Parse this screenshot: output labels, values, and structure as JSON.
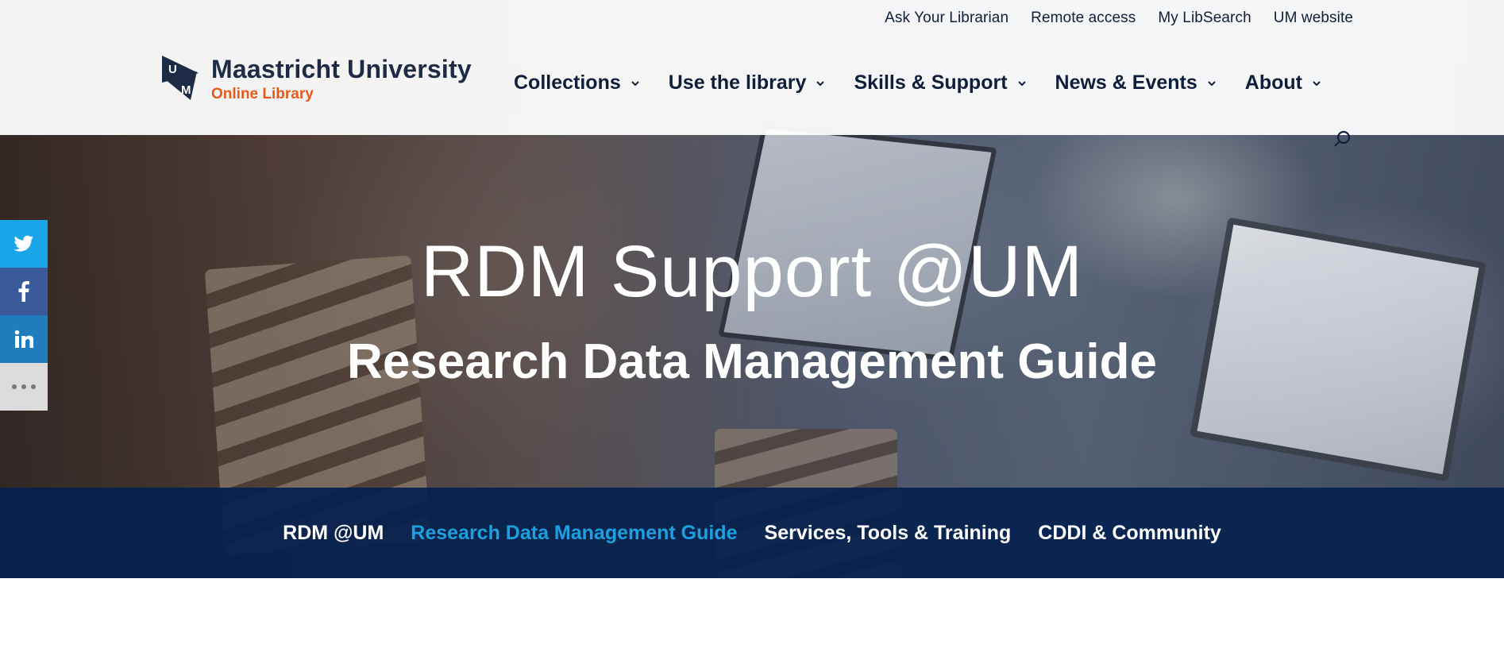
{
  "topbar": {
    "links": [
      "Ask Your Librarian",
      "Remote access",
      "My LibSearch",
      "UM website"
    ]
  },
  "logo": {
    "title": "Maastricht University",
    "subtitle": "Online Library",
    "mark_letters": [
      "U",
      "M"
    ]
  },
  "mainnav": {
    "items": [
      "Collections",
      "Use the library",
      "Skills & Support",
      "News & Events",
      "About"
    ]
  },
  "hero": {
    "title": "RDM Support @UM",
    "subtitle": "Research Data Management Guide"
  },
  "subnav": {
    "items": [
      "RDM @UM",
      "Research Data Management Guide",
      "Services, Tools & Training",
      "CDDI & Community"
    ],
    "active": "Research Data Management Guide"
  },
  "social": {
    "icons": [
      "twitter-icon",
      "facebook-icon",
      "linkedin-icon",
      "more-icon"
    ],
    "colors": {
      "twitter": "#1aa5e8",
      "facebook": "#3b5a9a",
      "linkedin": "#1f7cbd",
      "more": "#dcdcdc"
    }
  },
  "colors": {
    "accent": "#1da0e0",
    "brand_orange": "#e8591a",
    "navy": "#04214e"
  }
}
